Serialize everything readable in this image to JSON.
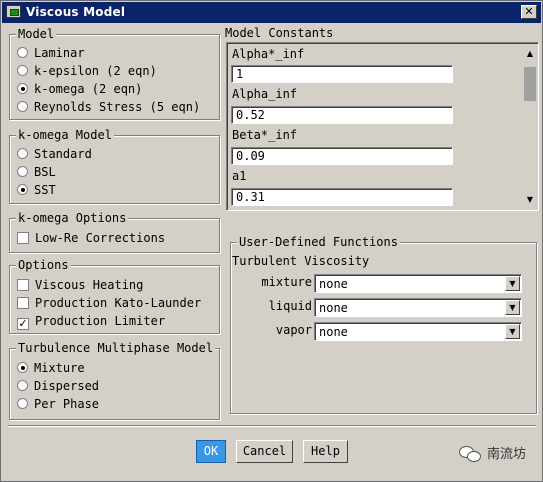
{
  "window": {
    "title": "Viscous Model",
    "close_glyph": "✕"
  },
  "model_group": {
    "title": "Model",
    "options": [
      {
        "label": "Laminar",
        "selected": false
      },
      {
        "label": "k-epsilon (2 eqn)",
        "selected": false
      },
      {
        "label": "k-omega (2 eqn)",
        "selected": true
      },
      {
        "label": "Reynolds Stress (5 eqn)",
        "selected": false
      }
    ]
  },
  "komega_model_group": {
    "title": "k-omega Model",
    "options": [
      {
        "label": "Standard",
        "selected": false
      },
      {
        "label": "BSL",
        "selected": false
      },
      {
        "label": "SST",
        "selected": true
      }
    ]
  },
  "komega_options_group": {
    "title": "k-omega Options",
    "options": [
      {
        "label": "Low-Re Corrections",
        "checked": false
      }
    ]
  },
  "options_group": {
    "title": "Options",
    "options": [
      {
        "label": "Viscous Heating",
        "checked": false
      },
      {
        "label": "Production Kato-Launder",
        "checked": false
      },
      {
        "label": "Production Limiter",
        "checked": true
      }
    ]
  },
  "multiphase_group": {
    "title": "Turbulence Multiphase Model",
    "options": [
      {
        "label": "Mixture",
        "selected": true
      },
      {
        "label": "Dispersed",
        "selected": false
      },
      {
        "label": "Per Phase",
        "selected": false
      }
    ]
  },
  "model_constants": {
    "title": "Model Constants",
    "items": [
      {
        "label": "Alpha*_inf",
        "value": "1"
      },
      {
        "label": "Alpha_inf",
        "value": "0.52"
      },
      {
        "label": "Beta*_inf",
        "value": "0.09"
      },
      {
        "label": "a1",
        "value": "0.31"
      }
    ],
    "scroll_up_glyph": "▲",
    "scroll_down_glyph": "▼"
  },
  "udf_group": {
    "title": "User-Defined Functions",
    "subtitle": "Turbulent Viscosity",
    "rows": [
      {
        "label": "mixture",
        "value": "none"
      },
      {
        "label": "liquid",
        "value": "none"
      },
      {
        "label": "vapor",
        "value": "none"
      }
    ],
    "dropdown_glyph": "▼"
  },
  "buttons": {
    "ok": "OK",
    "cancel": "Cancel",
    "help": "Help"
  },
  "watermark": {
    "text": "南流坊"
  }
}
